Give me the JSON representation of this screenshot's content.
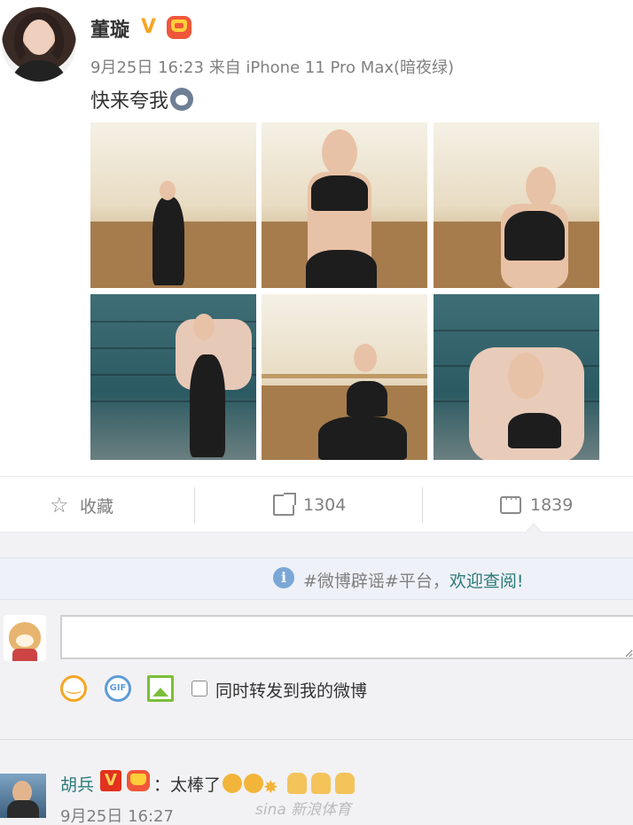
{
  "post": {
    "author": "董璇",
    "verified_mark": "V",
    "timestamp": "9月25日 16:23",
    "source": "来自 iPhone 11 Pro Max(暗夜绿)",
    "text": "快来夸我",
    "photo_count": 6
  },
  "actions": {
    "favorite_label": "收藏",
    "repost_count": "1304",
    "comment_count": "1839"
  },
  "notice": {
    "prefix": "#微博辟谣#平台，",
    "link": "欢迎查阅!"
  },
  "composer": {
    "input_value": "",
    "icons": [
      "smile-icon",
      "gif-icon",
      "image-icon"
    ],
    "gif_label": "GIF",
    "repost_checkbox_label": "同时转发到我的微博",
    "repost_checked": false
  },
  "comments": [
    {
      "user": "胡兵",
      "badge": "V",
      "text": "：太棒了",
      "emojis": [
        "clap-icon",
        "clap-icon",
        "sparkle-icon",
        "thumbs-up-icon",
        "thumbs-up-icon",
        "thumbs-up-icon"
      ],
      "time": "9月25日 16:27"
    }
  ],
  "watermark": "sina 新浪体育",
  "colors": {
    "link": "#2b7a78",
    "muted": "#808080",
    "verified_gold": "#f5a623",
    "vip_red": "#e2321e"
  }
}
